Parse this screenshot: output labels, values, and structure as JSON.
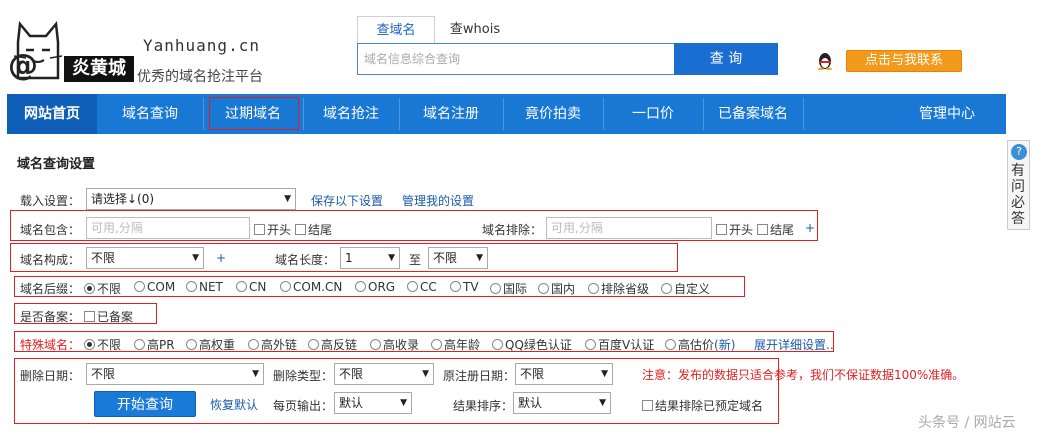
{
  "header": {
    "logo_text": "炎黄城",
    "site_url": "Yanhuang.cn",
    "slogan": "优秀的域名抢注平台",
    "search_tabs": [
      "查域名",
      "查whois"
    ],
    "search_placeholder": "域名信息综合查询",
    "search_button": "查 询",
    "contact_button": "点击与我联系"
  },
  "nav": {
    "items": [
      "网站首页",
      "域名查询",
      "过期域名",
      "域名抢注",
      "域名注册",
      "竟价拍卖",
      "一口价",
      "已备案域名",
      "管理中心"
    ]
  },
  "side": {
    "text": "有问必答",
    "icon": "?"
  },
  "settings": {
    "title": "域名查询设置",
    "load": {
      "label": "载入设置：",
      "value": "请选择↓(0)",
      "save_link": "保存以下设置",
      "manage_link": "管理我的设置"
    },
    "contains": {
      "label": "域名包含：",
      "placeholder": "可用,分隔",
      "opt_start": "开头",
      "opt_end": "结尾"
    },
    "excludes": {
      "label": "域名排除：",
      "placeholder": "可用,分隔",
      "opt_start": "开头",
      "opt_end": "结尾",
      "plus": "+"
    },
    "composition": {
      "label": "域名构成：",
      "value": "不限",
      "plus": "+"
    },
    "length": {
      "label": "域名长度：",
      "from": "1",
      "to_label": "至",
      "to": "不限"
    },
    "suffix": {
      "label": "域名后缀：",
      "options": [
        "不限",
        "COM",
        "NET",
        "CN",
        "COM.CN",
        "ORG",
        "CC",
        "TV",
        "国际",
        "国内",
        "排除省级",
        "自定义"
      ]
    },
    "filed": {
      "label": "是否备案：",
      "option": "已备案"
    },
    "special": {
      "label": "特殊域名：",
      "options": [
        "不限",
        "高PR",
        "高权重",
        "高外链",
        "高反链",
        "高收录",
        "高年龄",
        "QQ绿色认证",
        "百度V认证",
        "高估价"
      ],
      "new_tag": "(新)",
      "expand_link": "展开详细设置.."
    },
    "delete_date": {
      "label": "删除日期：",
      "value": "不限"
    },
    "delete_type": {
      "label": "删除类型：",
      "value": "不限"
    },
    "orig_reg_date": {
      "label": "原注册日期：",
      "value": "不限"
    },
    "notice": "注意：发布的数据只适合参考，我们不保证数据100%准确。",
    "start_button": "开始查询",
    "reset_link": "恢复默认",
    "per_page": {
      "label": "每页输出：",
      "value": "默认"
    },
    "sort": {
      "label": "结果排序：",
      "value": "默认"
    },
    "exclude_reserved": "结果排除已预定域名"
  },
  "watermark": "头条号 / 网站云"
}
